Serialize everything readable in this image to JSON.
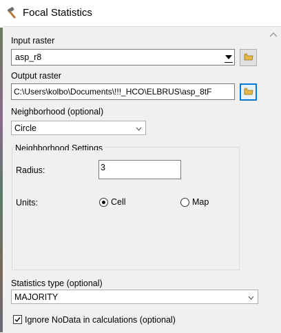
{
  "window": {
    "title": "Focal Statistics",
    "icon": "hammer-icon"
  },
  "input_raster": {
    "label": "Input raster",
    "value": "asp_r8"
  },
  "output_raster": {
    "label": "Output raster",
    "value": "C:\\Users\\kolbo\\Documents\\!!!_HCO\\ELBRUS\\asp_8tF"
  },
  "neighborhood": {
    "label": "Neighborhood (optional)",
    "selected": "Circle"
  },
  "settings": {
    "group_title": "Neighborhood Settings",
    "radius_label": "Radius:",
    "radius_value": "3",
    "units_label": "Units:",
    "units_options": [
      {
        "label": "Cell",
        "selected": true
      },
      {
        "label": "Map",
        "selected": false
      }
    ]
  },
  "statistics_type": {
    "label": "Statistics type (optional)",
    "selected": "MAJORITY"
  },
  "ignore_nodata": {
    "label": "Ignore NoData in calculations (optional)",
    "checked": true
  },
  "colors": {
    "focus_blue": "#0078d7",
    "panel_bg": "#f0f0f0"
  }
}
